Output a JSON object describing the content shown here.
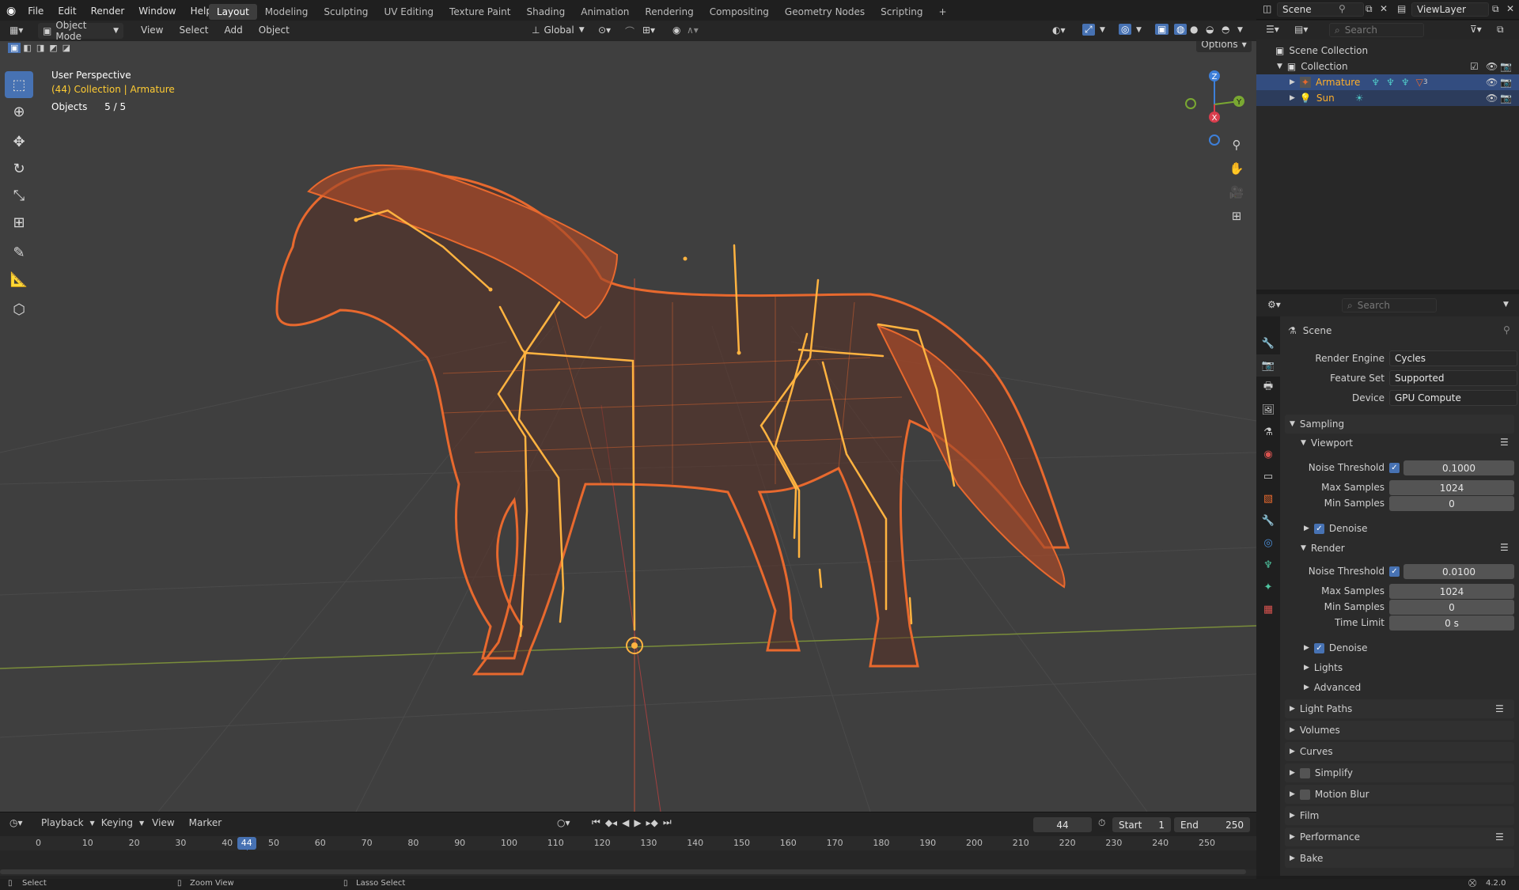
{
  "topbar": {
    "menus": [
      "File",
      "Edit",
      "Render",
      "Window",
      "Help"
    ],
    "workspaces": [
      "Layout",
      "Modeling",
      "Sculpting",
      "UV Editing",
      "Texture Paint",
      "Shading",
      "Animation",
      "Rendering",
      "Compositing",
      "Geometry Nodes",
      "Scripting"
    ],
    "active_workspace": "Layout",
    "add_tab": "+",
    "scene": "Scene",
    "view_layer": "ViewLayer"
  },
  "viewport_header": {
    "mode": "Object Mode",
    "menus": [
      "View",
      "Select",
      "Add",
      "Object"
    ],
    "orientation": "Global",
    "options": "Options"
  },
  "viewport": {
    "view_name": "User Perspective",
    "collection_info": "(44) Collection | Armature",
    "objects_label": "Objects",
    "objects_count": "5 / 5",
    "gizmo_axes": [
      "Z",
      "Y",
      "X"
    ],
    "colors": {
      "selected": "#e8692e",
      "bone": "#ffb340",
      "bg": "#3f3f3f",
      "accent": "#4772b3"
    }
  },
  "outliner": {
    "search_placeholder": "Search",
    "scene_collection": "Scene Collection",
    "collection": "Collection",
    "items": [
      {
        "name": "Armature",
        "selected": true,
        "badge": "3"
      },
      {
        "name": "Sun",
        "selected": true
      }
    ]
  },
  "properties": {
    "search_placeholder": "Search",
    "context": "Scene",
    "render_engine_label": "Render Engine",
    "render_engine": "Cycles",
    "feature_set_label": "Feature Set",
    "feature_set": "Supported",
    "device_label": "Device",
    "device": "GPU Compute",
    "sampling": "Sampling",
    "viewport": {
      "title": "Viewport",
      "noise_threshold_label": "Noise Threshold",
      "noise_threshold": "0.1000",
      "max_samples_label": "Max Samples",
      "max_samples": "1024",
      "min_samples_label": "Min Samples",
      "min_samples": "0",
      "denoise": "Denoise"
    },
    "render": {
      "title": "Render",
      "noise_threshold_label": "Noise Threshold",
      "noise_threshold": "0.0100",
      "max_samples_label": "Max Samples",
      "max_samples": "1024",
      "min_samples_label": "Min Samples",
      "min_samples": "0",
      "time_limit_label": "Time Limit",
      "time_limit": "0 s",
      "denoise": "Denoise"
    },
    "sub_panels": [
      "Lights",
      "Advanced"
    ],
    "panels": [
      "Light Paths",
      "Volumes",
      "Curves",
      "Simplify",
      "Motion Blur",
      "Film",
      "Performance",
      "Bake"
    ]
  },
  "timeline": {
    "menus": [
      "Playback",
      "Keying",
      "View",
      "Marker"
    ],
    "current_frame": "44",
    "start_label": "Start",
    "start": "1",
    "end_label": "End",
    "end": "250",
    "ruler": [
      "0",
      "10",
      "20",
      "30",
      "40",
      "50",
      "60",
      "70",
      "80",
      "90",
      "100",
      "110",
      "120",
      "130",
      "140",
      "150",
      "160",
      "170",
      "180",
      "190",
      "200",
      "210",
      "220",
      "230",
      "240",
      "250"
    ]
  },
  "statusbar": {
    "select": "Select",
    "zoom": "Zoom View",
    "lasso": "Lasso Select",
    "version": "4.2.0"
  }
}
